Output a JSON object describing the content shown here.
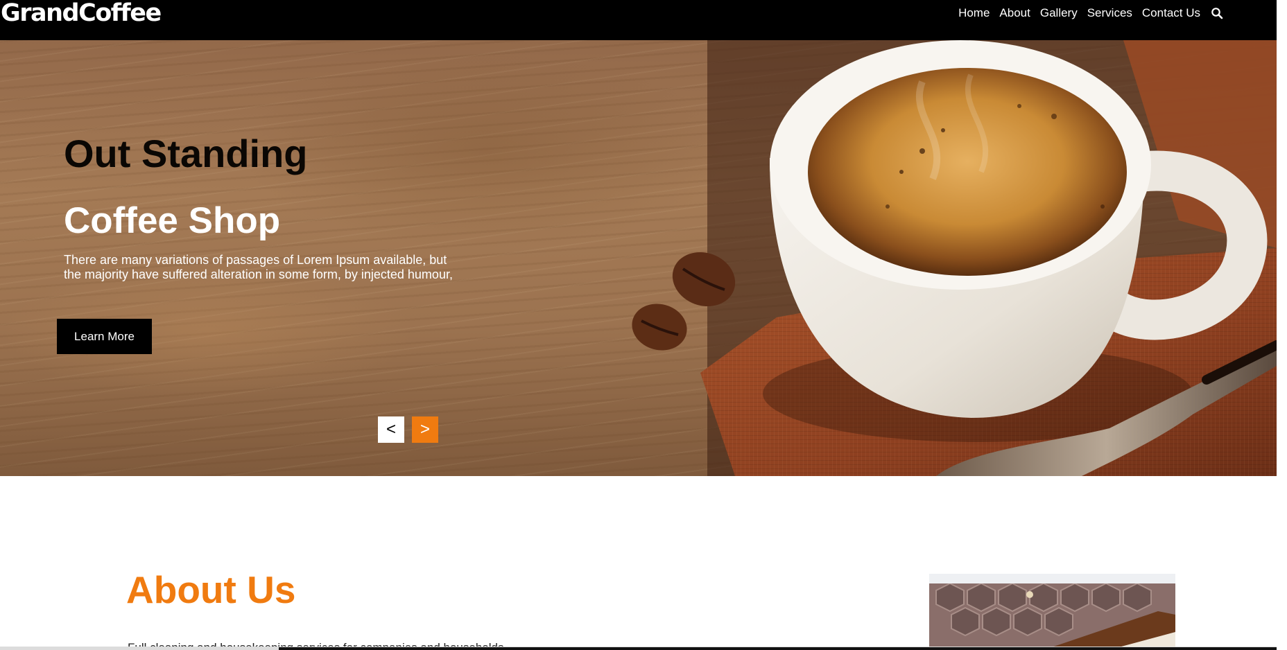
{
  "header": {
    "logo": "GrandCoffee",
    "nav": [
      "Home",
      "About",
      "Gallery",
      "Services",
      "Contact Us"
    ],
    "search_icon": "search-icon"
  },
  "hero": {
    "title_line1": "Out Standing",
    "title_line2": "Coffee Shop",
    "description": "There are many variations of passages of Lorem Ipsum available, but the majority have suffered alteration in some form, by injected humour,",
    "button_label": "Learn More",
    "prev_label": "<",
    "next_label": ">",
    "image": "coffee cup with beans and spoon on burlap"
  },
  "about": {
    "title": "About Us",
    "text": "Full cleaning and housekeeping services for companies and households."
  },
  "colors": {
    "header_bg": "#000000",
    "accent": "#f07b10",
    "hero_title_dark": "#0a0704",
    "hero_title_light": "#ffffff"
  }
}
